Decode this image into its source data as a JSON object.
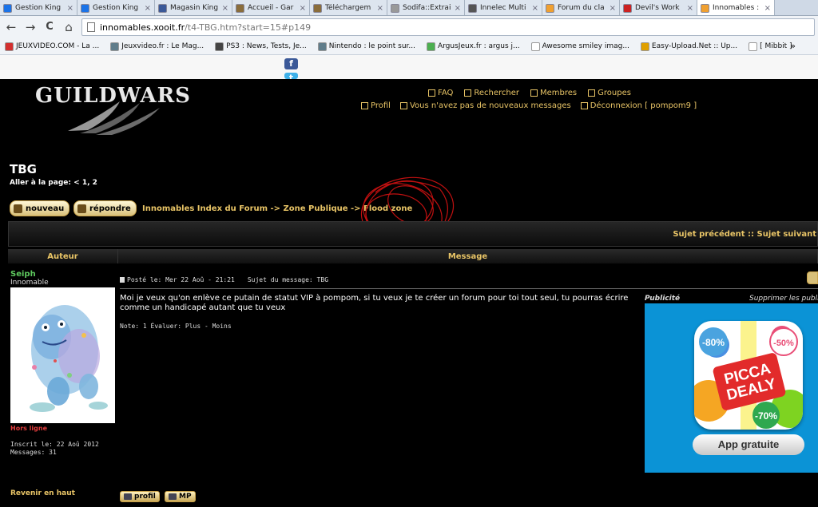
{
  "browser": {
    "tabs": [
      {
        "label": "Gestion King",
        "icon_color": "#1a73e8",
        "active": false
      },
      {
        "label": "Gestion King",
        "icon_color": "#1a73e8",
        "active": false
      },
      {
        "label": "Magasin King",
        "icon_color": "#3b5998",
        "active": false
      },
      {
        "label": "Accueil - Gar",
        "icon_color": "#8a6d3b",
        "active": false
      },
      {
        "label": "Téléchargem",
        "icon_color": "#8a6d3b",
        "active": false
      },
      {
        "label": "Sodifa::Extrai",
        "icon_color": "#999999",
        "active": false
      },
      {
        "label": "Innelec Multi",
        "icon_color": "#555555",
        "active": false
      },
      {
        "label": "Forum du cla",
        "icon_color": "#f0a030",
        "active": false
      },
      {
        "label": "Devil's Work",
        "icon_color": "#cc2222",
        "active": false
      },
      {
        "label": "Innomables :",
        "icon_color": "#f0a030",
        "active": true
      }
    ],
    "close_glyph": "×",
    "nav": {
      "back": "←",
      "forward": "→",
      "reload": "C",
      "home": "⌂"
    },
    "url": {
      "domain": "innomables.xooit.fr",
      "path": "/t4-TBG.htm?start=15#p149"
    },
    "bookmarks": [
      {
        "label": "JEUXVIDEO.COM - La ...",
        "icon_color": "#d32f2f"
      },
      {
        "label": "Jeuxvideo.fr : Le Mag...",
        "icon_color": "#607d8b"
      },
      {
        "label": "PS3 : News, Tests, Je...",
        "icon_color": "#444444"
      },
      {
        "label": "Nintendo : le point sur...",
        "icon_color": "#607d8b"
      },
      {
        "label": "ArgusJeux.fr : argus j...",
        "icon_color": "#4caf50"
      },
      {
        "label": "Awesome smiley imag...",
        "icon_color": "#ffffff"
      },
      {
        "label": "Easy-Upload.Net :: Up...",
        "icon_color": "#e0a000"
      },
      {
        "label": "[ Mibbit ]",
        "icon_color": "#ffffff"
      }
    ],
    "bookmarks_more": "»"
  },
  "social": {
    "facebook": "f",
    "twitter": "t"
  },
  "header": {
    "logo": "GUILDWARS",
    "nav_row1": [
      {
        "label": "FAQ",
        "icon": "question-icon"
      },
      {
        "label": "Rechercher",
        "icon": "search-icon"
      },
      {
        "label": "Membres",
        "icon": "members-icon"
      },
      {
        "label": "Groupes",
        "icon": "groups-icon"
      }
    ],
    "nav_row2": [
      {
        "label": "Profil",
        "icon": "profile-icon"
      },
      {
        "label": "Vous n'avez pas de nouveaux messages",
        "icon": "messages-icon"
      },
      {
        "label": "Déconnexion [ pompom9 ]",
        "icon": "logout-icon"
      }
    ],
    "link_color": "#e8c466"
  },
  "topic": {
    "title": "TBG",
    "pager_label": "Aller à la page:",
    "pager_prev": "<",
    "pager_pages": "1, 2",
    "new_button": "nouveau",
    "reply_button": "répondre",
    "breadcrumb": "Innomables Index du Forum -> Zone Publique -> Flood zone",
    "prev_next": "Sujet précédent :: Sujet suivant"
  },
  "table": {
    "author_header": "Auteur",
    "message_header": "Message"
  },
  "post": {
    "author": {
      "name": "Seiph",
      "name_color": "#5ec85e",
      "rank": "Innomable",
      "status": "Hors ligne",
      "status_color": "#e23c3c",
      "joined": "Inscrit le: 22 Aoû 2012",
      "messages": "Messages: 31"
    },
    "posted": "Posté le: Mer 22 Aoû - 21:21",
    "subject": "Sujet du message: TBG",
    "body": "Moi je veux qu'on enlève ce putain de statut VIP à pompom, si tu veux je te créer un forum pour toi tout seul, tu pourras écrire comme un handicapé autant que tu veux",
    "rating": "Note: 1  Évaluer: Plus - Moins",
    "profile_button": "profil",
    "pm_button": "MP",
    "back_to_top": "Revenir en haut"
  },
  "ad": {
    "label": "Publicité",
    "remove": "Supprimer les publicités ?",
    "brand_line1": "PICCA",
    "brand_line2": "DEALY",
    "badge_80": "-80%",
    "badge_50": "-50%",
    "badge_70": "-70%",
    "cta": "App gratuite",
    "bg_color": "#0b93d6"
  }
}
